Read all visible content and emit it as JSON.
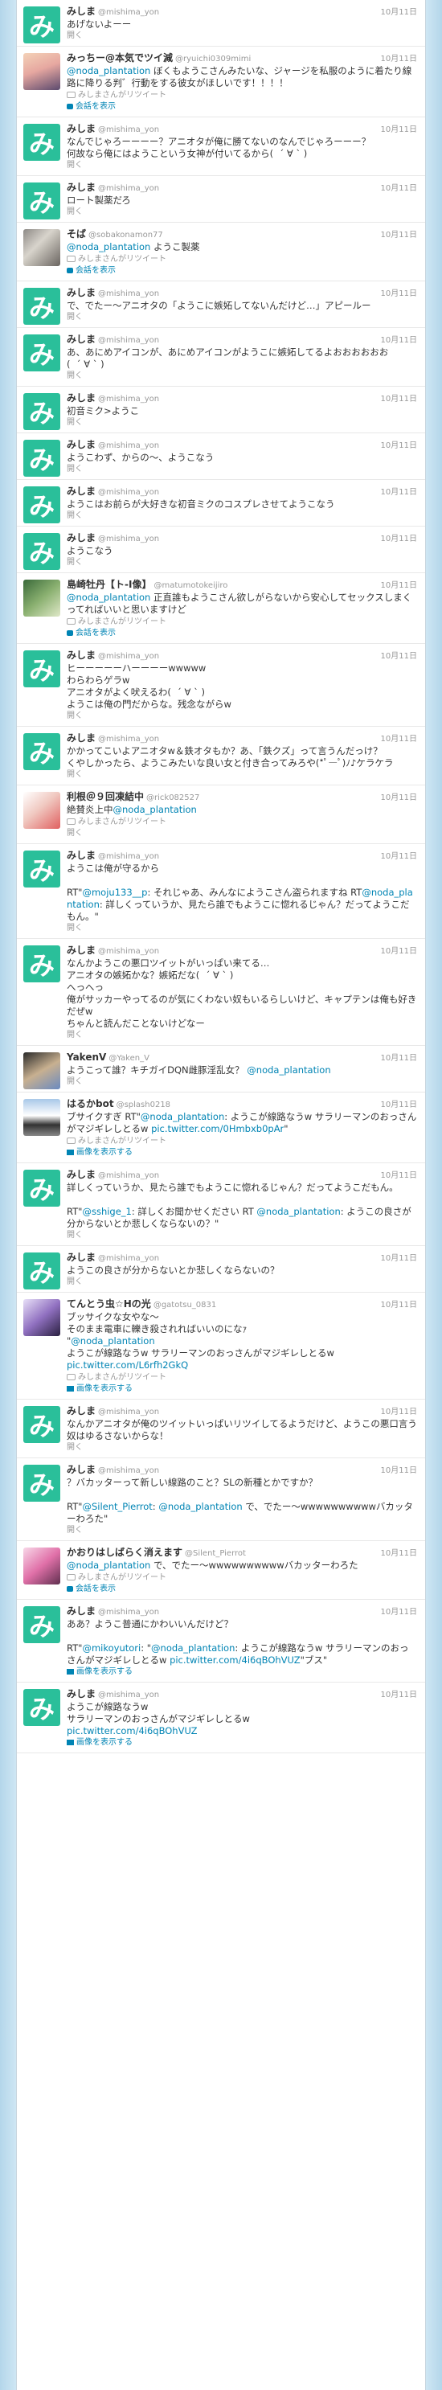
{
  "labels": {
    "open": "開く",
    "conversation": "会話を表示",
    "media": "画像を表示する",
    "rt_by": "みしまさんがリツイート"
  },
  "tweets": [
    {
      "avatar": "mi",
      "name": "みしま",
      "sn": "@mishima_yon",
      "time": "10月11日",
      "text": "あげないよーー",
      "rt": false,
      "action": "open"
    },
    {
      "avatar": "anime1",
      "name": "みっちー@本気でツイ減",
      "sn": "@ryuichi0309mimi",
      "time": "10月11日",
      "text": "@noda_plantation ぼくもようこさんみたいな、ジャージを私服のように着たり線路に降りる判゛行動をする彼女がほしいです！！！！",
      "rt": true,
      "action": "conversation"
    },
    {
      "avatar": "mi",
      "name": "みしま",
      "sn": "@mishima_yon",
      "time": "10月11日",
      "text": "なんでじゃろーーーー？アニオタが俺に勝てないのなんでじゃろーーー？\n何故なら俺にはようこという女神が付いてるから(  ´ ∀ ` )",
      "rt": false,
      "action": "open"
    },
    {
      "avatar": "mi",
      "name": "みしま",
      "sn": "@mishima_yon",
      "time": "10月11日",
      "text": "ロート製薬だろ",
      "rt": false,
      "action": "open"
    },
    {
      "avatar": "photo",
      "name": "そば",
      "sn": "@sobakonamon77",
      "time": "10月11日",
      "text": "@noda_plantation ようこ製薬",
      "rt": true,
      "action": "conversation"
    },
    {
      "avatar": "mi",
      "name": "みしま",
      "sn": "@mishima_yon",
      "time": "10月11日",
      "text": "で、でたー～アニオタの「ようこに嫉妬してないんだけど…」アピールー",
      "rt": false,
      "action": "open"
    },
    {
      "avatar": "mi",
      "name": "みしま",
      "sn": "@mishima_yon",
      "time": "10月11日",
      "text": "あ、あにめアイコンが、あにめアイコンがようこに嫉妬してるよおおおおおお\n(  ´ ∀ ` )",
      "rt": false,
      "action": "open"
    },
    {
      "avatar": "mi",
      "name": "みしま",
      "sn": "@mishima_yon",
      "time": "10月11日",
      "text": "初音ミク>ようこ",
      "rt": false,
      "action": "open"
    },
    {
      "avatar": "mi",
      "name": "みしま",
      "sn": "@mishima_yon",
      "time": "10月11日",
      "text": "ようこわず、からの～、ようこなう",
      "rt": false,
      "action": "open"
    },
    {
      "avatar": "mi",
      "name": "みしま",
      "sn": "@mishima_yon",
      "time": "10月11日",
      "text": "ようこはお前らが大好きな初音ミクのコスプレさせてようこなう",
      "rt": false,
      "action": "open"
    },
    {
      "avatar": "mi",
      "name": "みしま",
      "sn": "@mishima_yon",
      "time": "10月11日",
      "text": "ようこなう",
      "rt": false,
      "action": "open"
    },
    {
      "avatar": "green",
      "name": "島崎牡丹【ト-I像】",
      "sn": "@matumotokeijiro",
      "time": "10月11日",
      "text": "@noda_plantation 正直誰もようこさん欲しがらないから安心してセックスしまくってればいいと思いますけど",
      "rt": true,
      "action": "conversation"
    },
    {
      "avatar": "mi",
      "name": "みしま",
      "sn": "@mishima_yon",
      "time": "10月11日",
      "text": "ヒーーーーーハーーーーwwwww\nわらわらゲラw\nアニオタがよく吠えるわ(  ´ ∀ ` )\nようこは俺の門だからな。残念ながらw",
      "rt": false,
      "action": "open"
    },
    {
      "avatar": "mi",
      "name": "みしま",
      "sn": "@mishima_yon",
      "time": "10月11日",
      "text": "かかってこいよアニオタw＆鉄オタもか？あ、「鉄クズ」って言うんだっけ？\nくやしかったら、ようこみたいな良い女と付き合ってみろや(*ﾟ―ﾟ)ﾉ♪ケラケラ",
      "rt": false,
      "action": "open"
    },
    {
      "avatar": "sushi",
      "name": "利根＠９回凍結中",
      "sn": "@rick082527",
      "time": "10月11日",
      "text": "絶賛炎上中@noda_plantation",
      "rt": true,
      "action": "open"
    },
    {
      "avatar": "mi",
      "name": "みしま",
      "sn": "@mishima_yon",
      "time": "10月11日",
      "text": "ようこは俺が守るから\n\nRT\"@moju133__p: それじゃあ、みんなにようこさん盗られますね RT@noda_plantation: 詳しくっていうか、見たら誰でもようこに惚れるじゃん？だってようこだもん。\"",
      "rt": false,
      "action": "open"
    },
    {
      "avatar": "mi",
      "name": "みしま",
      "sn": "@mishima_yon",
      "time": "10月11日",
      "text": "なんかようこの悪口ツイットがいっぱい来てる…\nアニオタの嫉妬かな？嫉妬だな(  ´ ∀ ` )\nへっへっ\n俺がサッカーやってるのが気にくわない奴もいるらしいけど、キャプテンは俺も好きだぜw\nちゃんと読んだことないけどなー",
      "rt": false,
      "action": "open"
    },
    {
      "avatar": "anime2",
      "name": "YakenV",
      "sn": "@Yaken_V",
      "time": "10月11日",
      "text": "ようこって誰？キチガイDQN雌豚淫乱女？ @noda_plantation",
      "rt": false,
      "action": "open"
    },
    {
      "avatar": "rail",
      "name": "はるかbot",
      "sn": "@splash0218",
      "time": "10月11日",
      "text": "ブサイクすぎ RT\"@noda_plantation: ようこが線路なうw サラリーマンのおっさんがマジギレしとるw pic.twitter.com/0Hmbxb0pAr\"",
      "rt": true,
      "action": "media"
    },
    {
      "avatar": "mi",
      "name": "みしま",
      "sn": "@mishima_yon",
      "time": "10月11日",
      "text": "詳しくっていうか、見たら誰でもようこに惚れるじゃん？だってようこだもん。\n\nRT\"@sshige_1: 詳しくお聞かせください RT @noda_plantation: ようこの良さが分からないとか悲しくならないの？\"",
      "rt": false,
      "action": "open"
    },
    {
      "avatar": "mi",
      "name": "みしま",
      "sn": "@mishima_yon",
      "time": "10月11日",
      "text": "ようこの良さが分からないとか悲しくならないの？",
      "rt": false,
      "action": "open"
    },
    {
      "avatar": "purple",
      "name": "てんとう虫☆Hの光",
      "sn": "@gatotsu_0831",
      "time": "10月11日",
      "text": "ブッサイクな女やな～\nそのまま電車に轢き殺されればいいのになｧ\n\"@noda_plantation\nようこが線路なうw サラリーマンのおっさんがマジギレしとるw\npic.twitter.com/L6rfh2GkQ",
      "rt": true,
      "action": "media"
    },
    {
      "avatar": "mi",
      "name": "みしま",
      "sn": "@mishima_yon",
      "time": "10月11日",
      "text": "なんかアニオタが俺のツイットいっぱいリツイしてるようだけど、ようこの悪口言う奴はゆるさないからな！",
      "rt": false,
      "action": "open"
    },
    {
      "avatar": "mi",
      "name": "みしま",
      "sn": "@mishima_yon",
      "time": "10月11日",
      "text": "？バカッターって新しい線路のこと？SLの新種とかですか？\n\nRT\"@Silent_Pierrot: @noda_plantation で、でたー～wwwwwwwwwwバカッターわろた\"",
      "rt": false,
      "action": "open"
    },
    {
      "avatar": "pink",
      "name": "かおりはしばらく消えます",
      "sn": "@Silent_Pierrot",
      "time": "10月11日",
      "text": "@noda_plantation で、でたー～wwwwwwwwwwバカッターわろた",
      "rt": true,
      "action": "conversation"
    },
    {
      "avatar": "mi",
      "name": "みしま",
      "sn": "@mishima_yon",
      "time": "10月11日",
      "text": "ああ？ようこ普通にかわいいんだけど？\n\nRT\"@mikoyutori: \"@noda_plantation: ようこが線路なうw サラリーマンのおっさんがマジギレしとるw pic.twitter.com/4i6qBOhVUZ\"ブス\"",
      "rt": false,
      "action": "media"
    },
    {
      "avatar": "mi",
      "name": "みしま",
      "sn": "@mishima_yon",
      "time": "10月11日",
      "text": "ようこが線路なうw\nサラリーマンのおっさんがマジギレしとるw\npic.twitter.com/4i6qBOhVUZ",
      "rt": false,
      "action": "media"
    }
  ]
}
